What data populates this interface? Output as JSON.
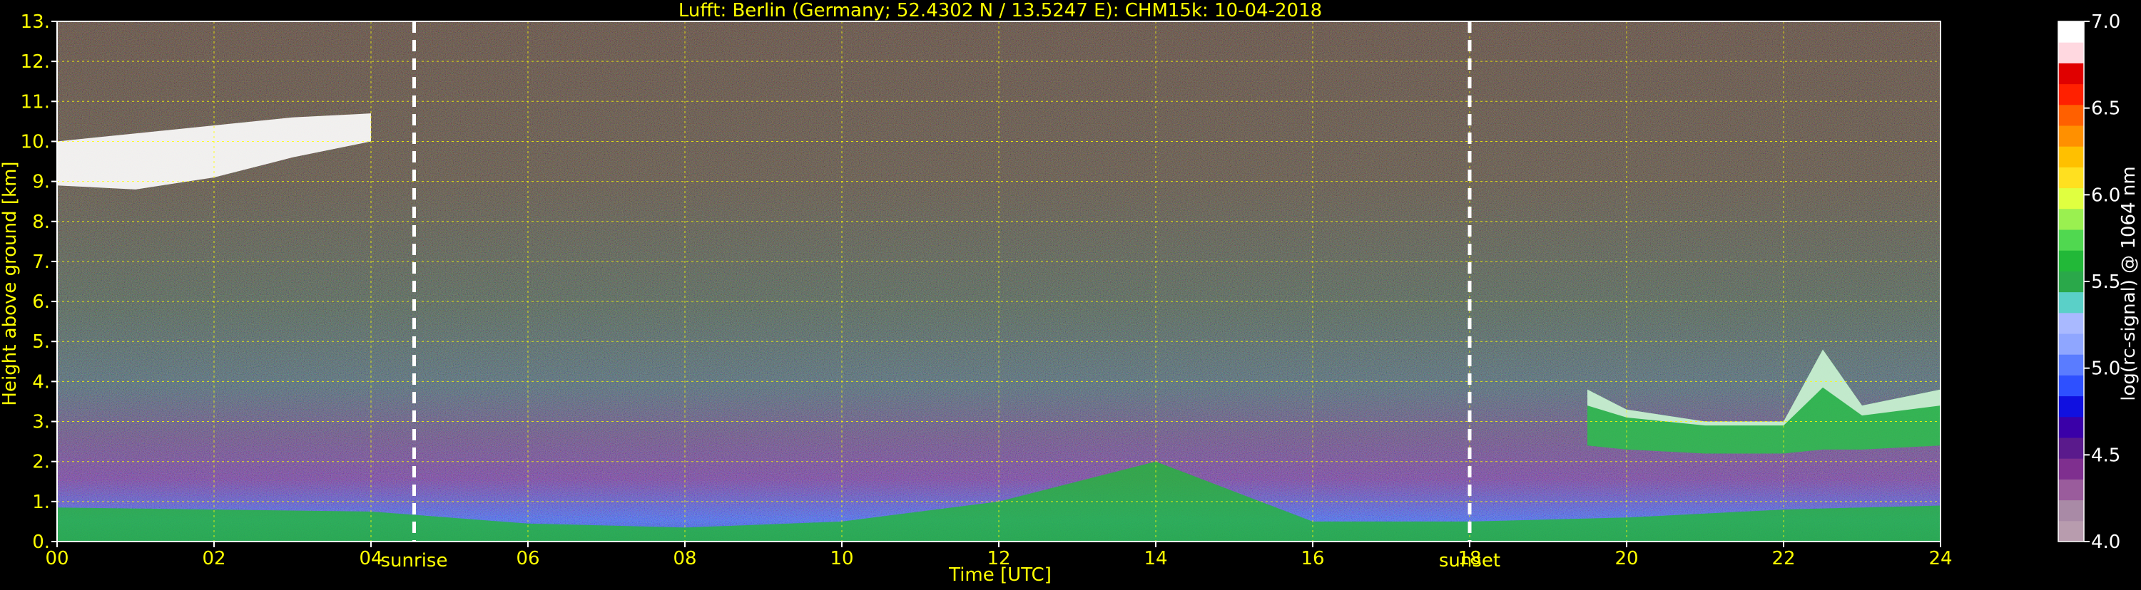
{
  "chart_data": {
    "type": "heatmap",
    "title": "Lufft: Berlin (Germany; 52.4302 N / 13.5247 E):    CHM15k: 10-04-2018",
    "xlabel": "Time [UTC]",
    "ylabel": "Height above ground [km]",
    "xlim": [
      0,
      24
    ],
    "ylim": [
      0,
      13
    ],
    "x_ticks": [
      0,
      2,
      4,
      6,
      8,
      10,
      12,
      14,
      16,
      18,
      20,
      22,
      24
    ],
    "x_tick_labels": [
      "00",
      "02",
      "04",
      "06",
      "08",
      "10",
      "12",
      "14",
      "16",
      "18",
      "20",
      "22",
      "24"
    ],
    "y_ticks": [
      0,
      1,
      2,
      3,
      4,
      5,
      6,
      7,
      8,
      9,
      10,
      11,
      12,
      13
    ],
    "y_tick_labels": [
      "0.",
      "1.",
      "2.",
      "3.",
      "4.",
      "5.",
      "6.",
      "7.",
      "8.",
      "9.",
      "10.",
      "11.",
      "12.",
      "13."
    ],
    "grid": true,
    "annotations": [
      {
        "label": "sunrise",
        "x": 4.55
      },
      {
        "label": "sunset",
        "x": 18.0
      }
    ],
    "colorbar": {
      "label": "log(rc-signal) @ 1064 nm",
      "range": [
        4.0,
        7.0
      ],
      "ticks": [
        4.0,
        4.5,
        5.0,
        5.5,
        6.0,
        6.5,
        7.0
      ],
      "tick_labels": [
        "4.0",
        "4.5",
        "5.0",
        "5.5",
        "6.0",
        "6.5",
        "7.0"
      ],
      "colors": [
        "#b89cae",
        "#a98aa6",
        "#9a5c9c",
        "#7f2f8f",
        "#5a1a8c",
        "#3a00a8",
        "#1010e0",
        "#2e50ff",
        "#5a7cff",
        "#8fa6ff",
        "#a9b9ff",
        "#5ad0c8",
        "#2aa84a",
        "#22b838",
        "#50d850",
        "#9af050",
        "#e0ff40",
        "#ffe020",
        "#ffc000",
        "#ff9000",
        "#ff6000",
        "#ff2000",
        "#e00000",
        "#ffd8e0",
        "#ffffff"
      ]
    },
    "layers": [
      {
        "name": "aerosol layer",
        "t": [
          0,
          2,
          4,
          6,
          8,
          10,
          12,
          14,
          16,
          18,
          20,
          22,
          24
        ],
        "top_km": [
          0.85,
          0.8,
          0.75,
          0.45,
          0.35,
          0.5,
          1.0,
          2.0,
          0.5,
          0.5,
          0.6,
          0.8,
          0.9
        ]
      },
      {
        "name": "cirrus cloud",
        "t": [
          0,
          1,
          2,
          3,
          4
        ],
        "base_km": [
          8.9,
          8.8,
          9.1,
          9.6,
          10.0
        ],
        "top_km": [
          10.0,
          10.2,
          10.4,
          10.6,
          10.7
        ]
      },
      {
        "name": "mid-level cloud",
        "t": [
          19.5,
          20,
          21,
          22,
          22.5,
          23,
          24
        ],
        "base_km": [
          2.4,
          2.3,
          2.2,
          2.2,
          2.3,
          2.3,
          2.4
        ],
        "top_km": [
          3.8,
          3.3,
          3.0,
          3.0,
          4.8,
          3.4,
          3.8
        ]
      }
    ]
  }
}
